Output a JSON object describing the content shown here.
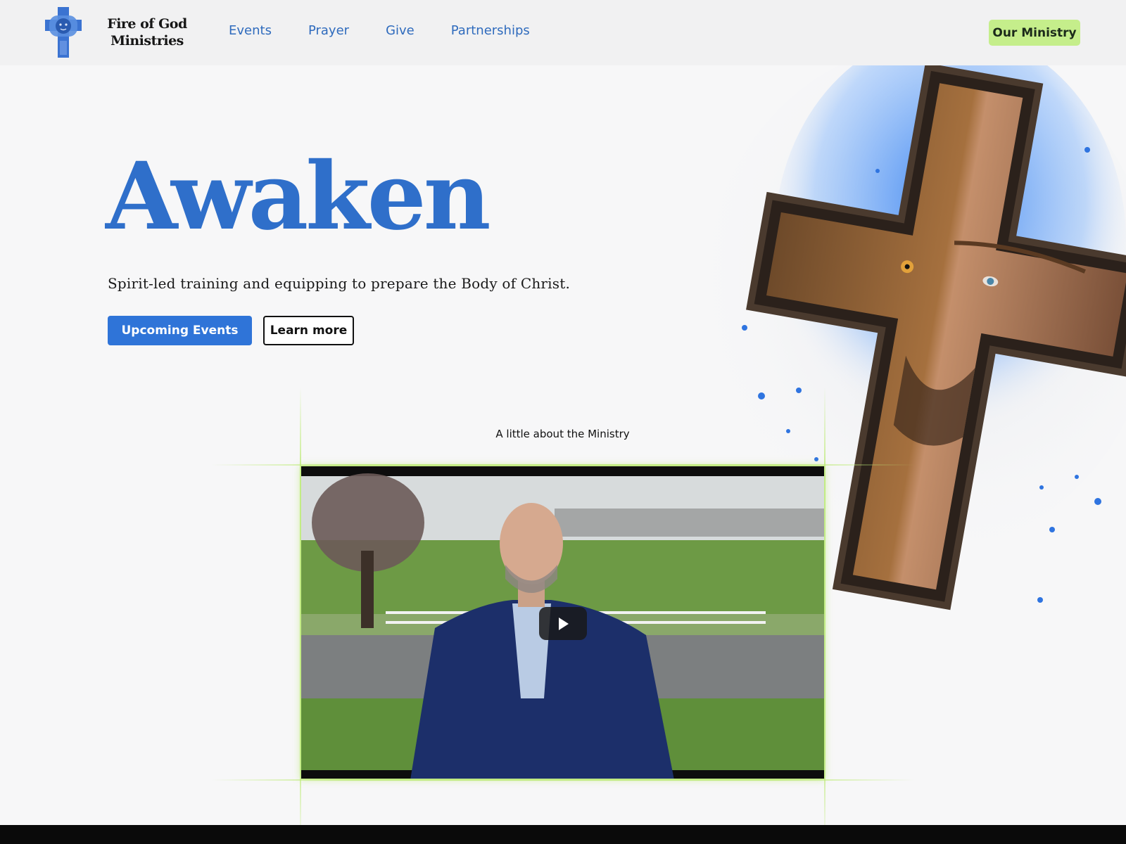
{
  "header": {
    "brand_line1": "Fire of God",
    "brand_line2": "Ministries",
    "nav": [
      "Events",
      "Prayer",
      "Give",
      "Partnerships"
    ],
    "cta_label": "Our Ministry"
  },
  "hero": {
    "title": "Awaken",
    "subtitle": "Spirit-led training and equipping to prepare the Body of Christ.",
    "primary_button": "Upcoming Events",
    "secondary_button": "Learn more"
  },
  "video_section": {
    "caption": "A little about the Ministry"
  },
  "colors": {
    "brand_blue": "#2f6fca",
    "nav_blue": "#2f6bbd",
    "accent_green": "#c5ee8b"
  },
  "icons": [
    "cross-lion-logo-icon",
    "play-icon"
  ]
}
